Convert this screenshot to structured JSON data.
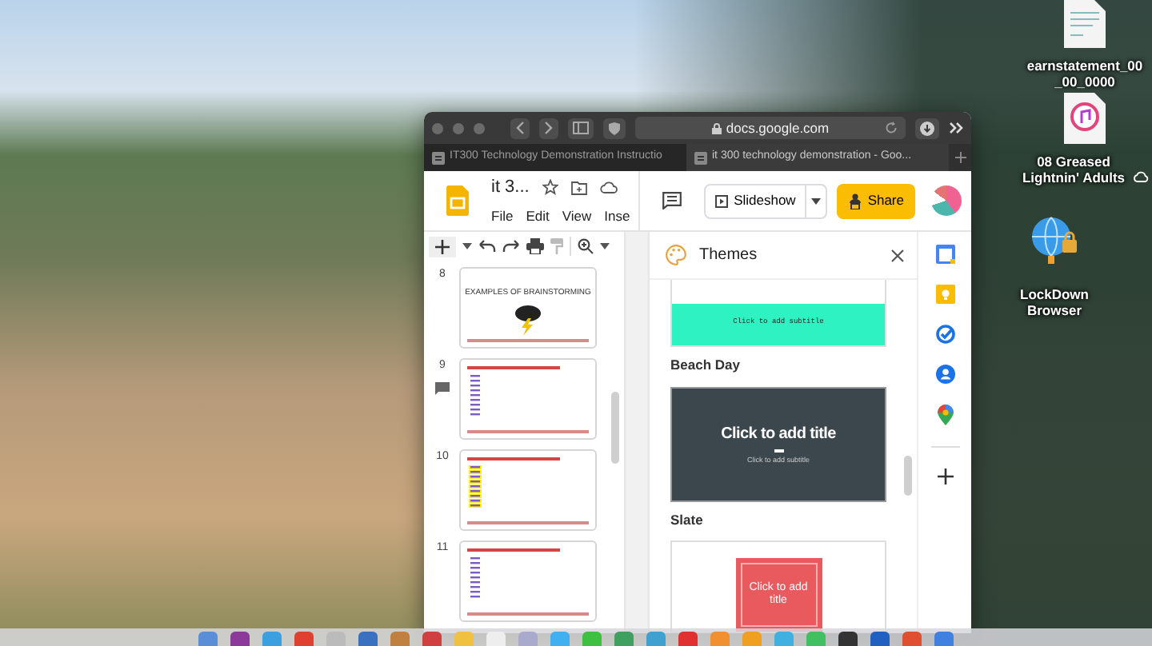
{
  "desktop": {
    "icons": [
      {
        "label": "earnstatement_00_00_0000",
        "kind": "document",
        "cloud": false
      },
      {
        "label": "08 Greased Lightnin' Adults",
        "kind": "audio",
        "cloud": true
      },
      {
        "label": "LockDown Browser",
        "kind": "app",
        "cloud": false
      }
    ]
  },
  "browser": {
    "address": "docs.google.com",
    "tabs": [
      {
        "label": "IT300 Technology Demonstration Instructio",
        "selected": false
      },
      {
        "label": "it 300 technology demonstration - Goo...",
        "selected": true
      }
    ]
  },
  "app": {
    "title": "it 3...",
    "menu": [
      "File",
      "Edit",
      "View",
      "Inse"
    ],
    "slideshow_button": "Slideshow",
    "share_button": "Share"
  },
  "filmstrip": {
    "slides": [
      {
        "number": "8",
        "kind": "image",
        "title": "EXAMPLES OF BRAINSTORMING",
        "comment": false
      },
      {
        "number": "9",
        "kind": "list",
        "comment": true
      },
      {
        "number": "10",
        "kind": "highlighted-list",
        "comment": false
      },
      {
        "number": "11",
        "kind": "list",
        "comment": false
      }
    ]
  },
  "themes_panel": {
    "title": "Themes",
    "themes": [
      {
        "kind": "band",
        "name": "Beach Day",
        "subtitle": "Click to add subtitle"
      },
      {
        "kind": "slate",
        "name": "Slate",
        "title": "Click to add title",
        "subtitle": "Click to add subtitle"
      },
      {
        "kind": "framed",
        "title": "Click to add title"
      }
    ]
  }
}
